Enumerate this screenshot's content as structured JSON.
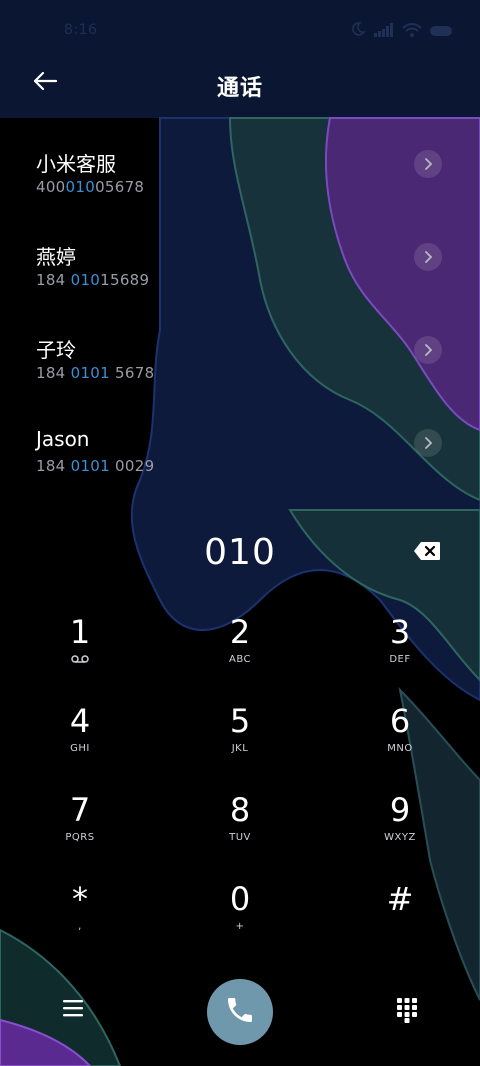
{
  "status_bar": {
    "time": "8:16",
    "icons": [
      "moon-icon",
      "signal-icon",
      "wifi-icon",
      "battery-icon"
    ]
  },
  "header": {
    "title": "通话",
    "back_icon": "back-arrow-icon"
  },
  "results": [
    {
      "name": "小米客服",
      "number_pre": "400",
      "number_match": "010",
      "number_post": "05678"
    },
    {
      "name": "燕婷",
      "number_pre": "184 ",
      "number_match": "010",
      "number_post": "15689"
    },
    {
      "name": "子玲",
      "number_pre": "184 ",
      "number_match": "0101",
      "number_post": " 5678"
    },
    {
      "name": "Jason",
      "number_pre": "184 ",
      "number_match": "0101",
      "number_post": " 0029"
    }
  ],
  "dialer": {
    "input": "010",
    "backspace_icon": "backspace-icon"
  },
  "keypad": [
    {
      "digit": "1",
      "letters": ""
    },
    {
      "digit": "2",
      "letters": "ABC"
    },
    {
      "digit": "3",
      "letters": "DEF"
    },
    {
      "digit": "4",
      "letters": "GHI"
    },
    {
      "digit": "5",
      "letters": "JKL"
    },
    {
      "digit": "6",
      "letters": "MNO"
    },
    {
      "digit": "7",
      "letters": "PQRS"
    },
    {
      "digit": "8",
      "letters": "TUV"
    },
    {
      "digit": "9",
      "letters": "WXYZ"
    },
    {
      "digit": "*",
      "letters": ","
    },
    {
      "digit": "0",
      "letters": "+"
    },
    {
      "digit": "#",
      "letters": ""
    }
  ],
  "bottom_bar": {
    "menu_icon": "menu-icon",
    "call_icon": "phone-icon",
    "keypad_icon": "dialpad-icon",
    "call_color": "#6f98ad"
  },
  "colors": {
    "accent": "#3a8fd6",
    "header_bg": "#0b1633"
  }
}
